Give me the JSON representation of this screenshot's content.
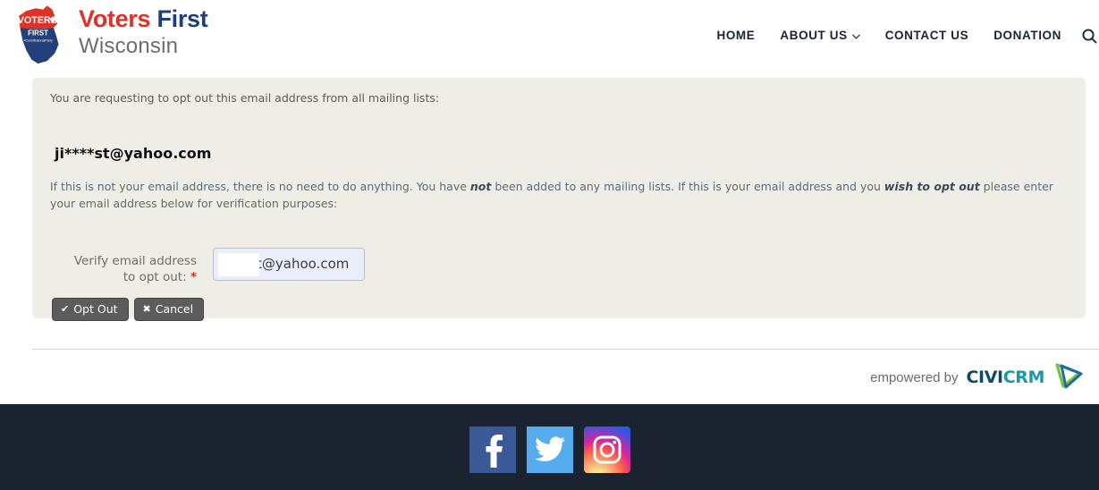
{
  "header": {
    "logo": {
      "icon": "wisconsin-state-logo",
      "state_label_top": "VOTERS",
      "state_label_mid": "FIRST",
      "state_label_small": "#ConstitutionalParty"
    },
    "brand_word1": "Voters",
    "brand_word2": "First",
    "brand_line2": "Wisconsin",
    "nav": [
      {
        "label": "HOME",
        "has_chevron": false
      },
      {
        "label": "ABOUT US",
        "has_chevron": true,
        "chevron": "⌄"
      },
      {
        "label": "CONTACT US",
        "has_chevron": false
      },
      {
        "label": "DONATION",
        "has_chevron": false
      }
    ],
    "search_icon": "search-icon"
  },
  "main": {
    "lead_text": "You are requesting to opt out this email address from all mailing lists:",
    "masked_email": "ji****st@yahoo.com",
    "description": {
      "part1": "If this is not your email address, there is no need to do anything. You have ",
      "bold1": "not",
      "part2": " been added to any mailing lists. If this is your email address and you ",
      "bold2": "wish to opt out",
      "part3": " please enter your email address below for verification purposes:"
    },
    "form": {
      "label_line1": "Verify email address",
      "label_line2": "to opt out:",
      "required_marker": "*",
      "email_value": "t@yahoo.com",
      "email_placeholder": ""
    },
    "buttons": [
      {
        "name": "opt-out-button",
        "glyph": "✔",
        "label": "Opt Out"
      },
      {
        "name": "cancel-button",
        "glyph": "✖",
        "label": "Cancel"
      }
    ],
    "credit": {
      "prefix": "empowered by",
      "brand_part1": "CIVI",
      "brand_part2": "CRM",
      "logo_icon": "civicrm-triangle-logo"
    }
  },
  "footer": {
    "social": [
      {
        "name": "facebook-icon",
        "label": "Facebook"
      },
      {
        "name": "twitter-icon",
        "label": "Twitter"
      },
      {
        "name": "instagram-icon",
        "label": "Instagram"
      }
    ]
  },
  "colors": {
    "brand_red": "#e03127",
    "brand_blue": "#1f3f7a",
    "panel_bg": "#eeeee6",
    "footer_bg": "#1b2230",
    "facebook": "#3b5998",
    "twitter": "#55acee",
    "required": "#c0392b"
  }
}
